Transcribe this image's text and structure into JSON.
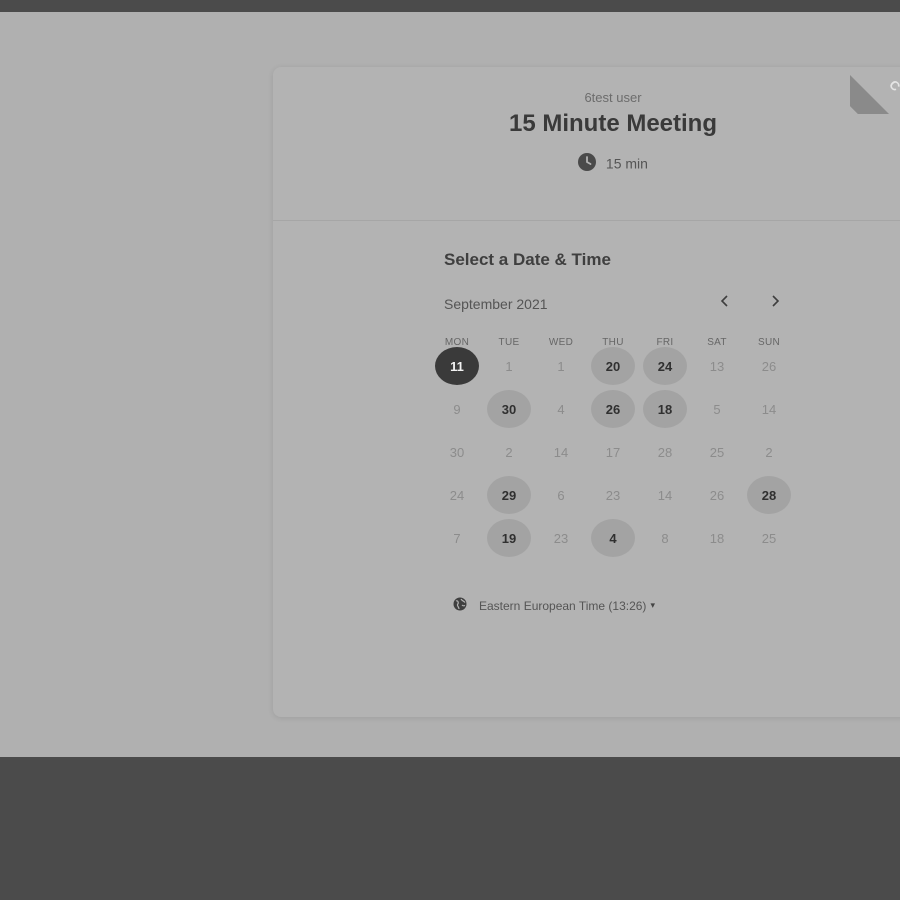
{
  "event": {
    "host": "6test user",
    "title": "15 Minute Meeting",
    "duration": "15 min"
  },
  "calendar": {
    "section_title": "Select a Date & Time",
    "month_label": "September 2021",
    "prev_icon": "chevron-left-icon",
    "next_icon": "chevron-right-icon",
    "weekdays": [
      "MON",
      "TUE",
      "WED",
      "THU",
      "FRI",
      "SAT",
      "SUN"
    ],
    "rows": [
      [
        {
          "label": "11",
          "state": "selected"
        },
        {
          "label": "1",
          "state": "disabled"
        },
        {
          "label": "1",
          "state": "disabled"
        },
        {
          "label": "20",
          "state": "available"
        },
        {
          "label": "24",
          "state": "available"
        },
        {
          "label": "13",
          "state": "disabled"
        },
        {
          "label": "26",
          "state": "disabled"
        }
      ],
      [
        {
          "label": "9",
          "state": "disabled"
        },
        {
          "label": "30",
          "state": "available"
        },
        {
          "label": "4",
          "state": "disabled"
        },
        {
          "label": "26",
          "state": "available"
        },
        {
          "label": "18",
          "state": "available"
        },
        {
          "label": "5",
          "state": "disabled"
        },
        {
          "label": "14",
          "state": "disabled"
        }
      ],
      [
        {
          "label": "30",
          "state": "disabled"
        },
        {
          "label": "2",
          "state": "disabled"
        },
        {
          "label": "14",
          "state": "disabled"
        },
        {
          "label": "17",
          "state": "disabled"
        },
        {
          "label": "28",
          "state": "disabled"
        },
        {
          "label": "25",
          "state": "disabled"
        },
        {
          "label": "2",
          "state": "disabled"
        }
      ],
      [
        {
          "label": "24",
          "state": "disabled"
        },
        {
          "label": "29",
          "state": "available"
        },
        {
          "label": "6",
          "state": "disabled"
        },
        {
          "label": "23",
          "state": "disabled"
        },
        {
          "label": "14",
          "state": "disabled"
        },
        {
          "label": "26",
          "state": "disabled"
        },
        {
          "label": "28",
          "state": "available"
        }
      ],
      [
        {
          "label": "7",
          "state": "disabled"
        },
        {
          "label": "19",
          "state": "available"
        },
        {
          "label": "23",
          "state": "disabled"
        },
        {
          "label": "4",
          "state": "available"
        },
        {
          "label": "8",
          "state": "disabled"
        },
        {
          "label": "18",
          "state": "disabled"
        },
        {
          "label": "25",
          "state": "disabled"
        }
      ]
    ]
  },
  "timezone": {
    "label": "Eastern European Time (13:26)",
    "icon": "globe-icon"
  },
  "ribbon": {
    "icon": "badge-icon"
  },
  "colors": {
    "selected_day": "#3a3a3a",
    "available_day": "#a3a3a3",
    "page_background": "#b0b0b0",
    "outer_background": "#4b4b4b"
  }
}
